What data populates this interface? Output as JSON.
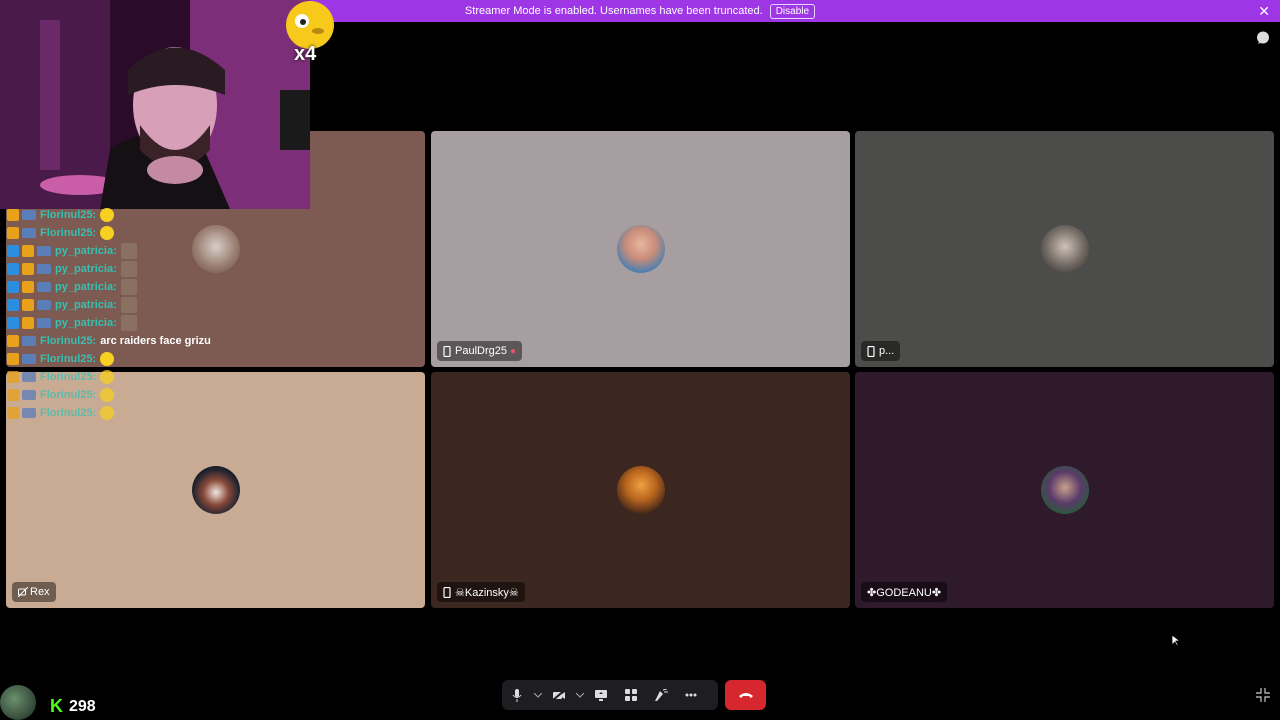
{
  "banner": {
    "text": "Streamer Mode is enabled. Usernames have been truncated.",
    "button_label": "Disable",
    "close_label": "✕"
  },
  "boost": {
    "multiplier": "x4"
  },
  "tiles": [
    {
      "name": "",
      "bg": "#7d5a52"
    },
    {
      "name": "PaulDrg25",
      "bg": "#a79ea1"
    },
    {
      "name": "p...",
      "bg": "#4c4c4a"
    },
    {
      "name": "Rex",
      "bg": "#c9ab94"
    },
    {
      "name": "☠Kazinsky☠",
      "bg": "#3b2620"
    },
    {
      "name": "✤GODEANU✤",
      "bg": "#2f1a2b"
    }
  ],
  "chat": [
    {
      "user": "Florinul25:",
      "msg": "",
      "emote": "emoji",
      "vip": false
    },
    {
      "user": "Florinul25:",
      "msg": "",
      "emote": "emoji",
      "vip": false
    },
    {
      "user": "py_patricia:",
      "msg": "",
      "emote": "pic",
      "vip": true
    },
    {
      "user": "py_patricia:",
      "msg": "",
      "emote": "pic",
      "vip": true
    },
    {
      "user": "py_patricia:",
      "msg": "",
      "emote": "pic",
      "vip": true
    },
    {
      "user": "py_patricia:",
      "msg": "",
      "emote": "pic",
      "vip": true
    },
    {
      "user": "py_patricia:",
      "msg": "",
      "emote": "pic",
      "vip": true
    },
    {
      "user": "Florinul25:",
      "msg": "arc raiders face grizu",
      "emote": "",
      "vip": false
    },
    {
      "user": "Florinul25:",
      "msg": "",
      "emote": "emoji",
      "vip": false
    },
    {
      "user": "Florinul25:",
      "msg": "",
      "emote": "emoji",
      "vip": false
    },
    {
      "user": "Florinul25:",
      "msg": "",
      "emote": "emoji",
      "vip": false
    },
    {
      "user": "Florinul25:",
      "msg": "",
      "emote": "emoji",
      "vip": false
    }
  ],
  "kick": {
    "logo": "K",
    "viewers": "298"
  },
  "controls": {
    "mic": "microphone-icon",
    "camera": "camera-off-icon",
    "share": "screen-share-icon",
    "activities": "activities-icon",
    "soundboard": "soundboard-icon",
    "more": "more-icon",
    "hangup": "hangup-icon"
  }
}
